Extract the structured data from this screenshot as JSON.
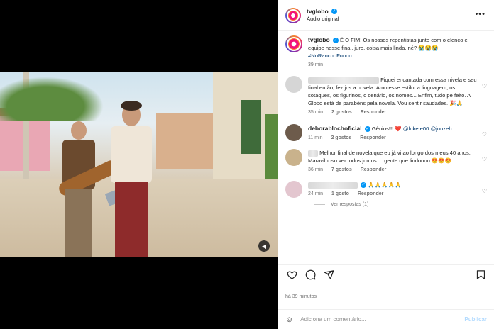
{
  "post": {
    "username": "tvglobo",
    "subtitle": "Áudio original",
    "caption_username": "tvglobo",
    "caption_text": "É O FIM! Os nossos repentistas junto com o elenco e equipe nesse final, juro, coisa mais linda, né? 😭😭😭",
    "caption_hashtag": "#NoRanchoFundo",
    "caption_time": "39 min"
  },
  "comments": [
    {
      "text": "Fiquei encantada com essa nivela e seu final então, fez jus a novela. Amo esse estilo, a linguagem, os sotaques, os figurinos, o cenário, os nomes... Enfim, tudo pe feito. A Globo está de parabéns pela novela. Vou sentir saudades. 🎉🙏",
      "time": "35 min",
      "likes": "2 gostos",
      "reply": "Responder"
    },
    {
      "username": "deborablochoficial",
      "text": "Gênios!!! ❤️",
      "mentions": "@lukete00 @juuzeh",
      "time": "11 min",
      "likes": "2 gostos",
      "reply": "Responder"
    },
    {
      "text": "Melhor final de novela que eu já vi ao longo dos meus 40 anos. Maravilhoso ver todos juntos ... gente que lindoooo 😍😍😍",
      "time": "36 min",
      "likes": "7 gostos",
      "reply": "Responder"
    },
    {
      "text": "🙏🙏🙏🙏🙏",
      "time": "24 min",
      "likes": "1 gosto",
      "reply": "Responder"
    }
  ],
  "view_replies": "Ver respostas (1)",
  "footer": {
    "time_ago": "há 39 minutos",
    "placeholder": "Adiciona um comentário...",
    "publish": "Publicar"
  },
  "colors": {
    "link": "#00376b",
    "verified": "#0095f6",
    "muted": "#737373"
  }
}
